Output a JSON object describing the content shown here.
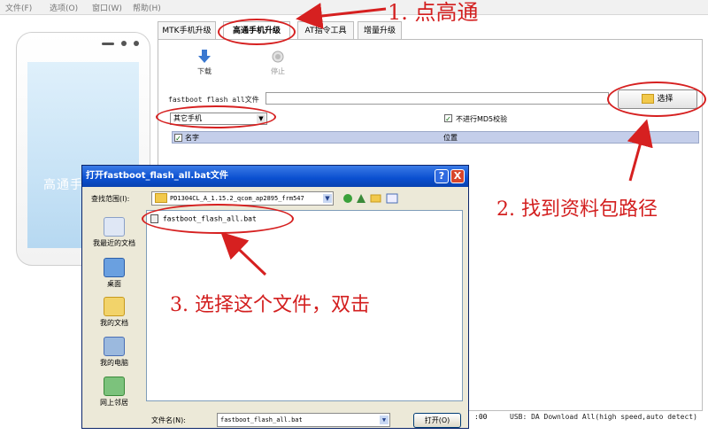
{
  "menubar": {
    "items": [
      "文件(F)",
      "选项(O)",
      "窗口(W)",
      "帮助(H)"
    ]
  },
  "phone": {
    "title": "高通手机升级"
  },
  "tabs": [
    {
      "label": "MTK手机升级"
    },
    {
      "label": "高通手机升级",
      "active": true
    },
    {
      "label": "AT指令工具"
    },
    {
      "label": "增量升级"
    }
  ],
  "toolbar": {
    "download_label": "下载",
    "stop_label": "停止"
  },
  "flash": {
    "file_label": "fastboot flash all文件",
    "file_value": "",
    "choose_label": "选择"
  },
  "phone_select": {
    "selected": "其它手机"
  },
  "md5": {
    "label": "不进行MD5校验",
    "checked": true
  },
  "list": {
    "columns": [
      "名字",
      "位置"
    ]
  },
  "status": {
    "time_fragment": ":00",
    "usb_text": "USB: DA Download All(high speed,auto detect)"
  },
  "dialog": {
    "title": "打开fastboot_flash_all.bat文件",
    "look_in_label": "查找范围(I):",
    "look_in_value": "PD1304CL_A_1.15.2_qcom_ap2895_frm547",
    "places": [
      "我最近的文档",
      "桌面",
      "我的文档",
      "我的电脑",
      "网上邻居"
    ],
    "files": [
      "fastboot_flash_all.bat"
    ],
    "filename_label": "文件名(N):",
    "filename_value": "fastboot_flash_all.bat",
    "open_label": "打开(O)",
    "help_glyph": "?",
    "close_glyph": "X"
  },
  "annotations": {
    "step1": "1. 点高通",
    "step2": "2. 找到资料包路径",
    "step3": "3. 选择这个文件，双击"
  },
  "colors": {
    "annotation": "#d31f1f",
    "titlebar": "#0a4fd0",
    "dialog_bg": "#ece9d8"
  }
}
